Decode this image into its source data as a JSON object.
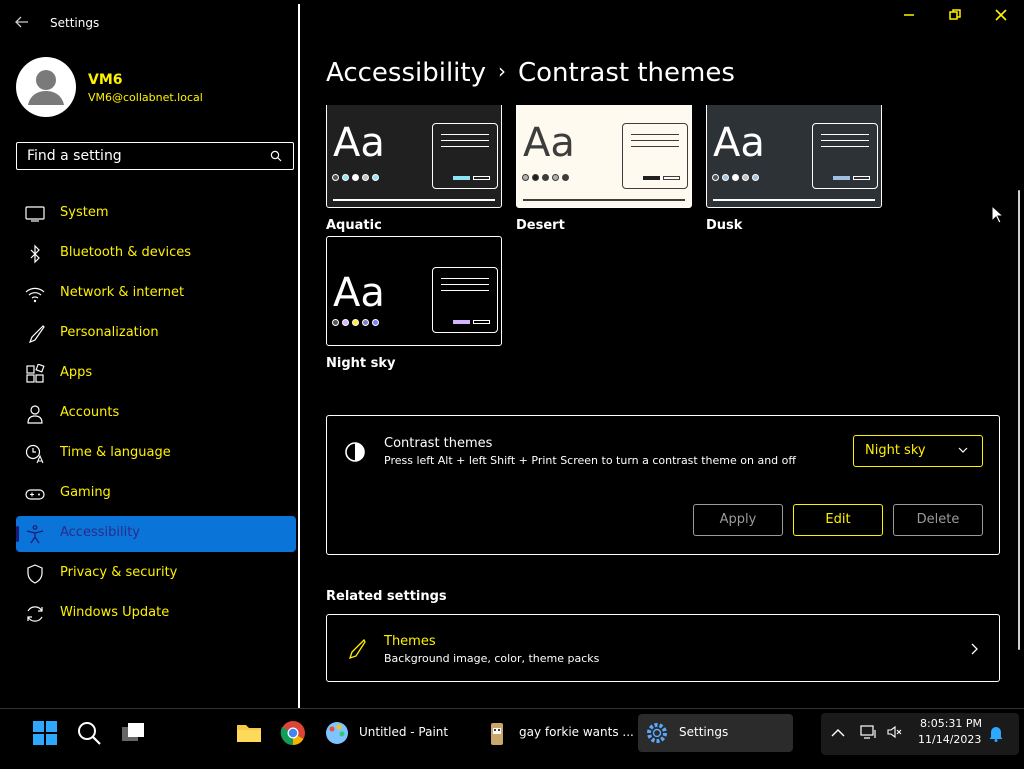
{
  "window": {
    "title": "Settings",
    "controls": {
      "minimize": "—",
      "restore": "⧉",
      "close": "✕"
    }
  },
  "user": {
    "name": "VM6",
    "email": "VM6@collabnet.local"
  },
  "search": {
    "placeholder": "Find a setting"
  },
  "sidebar": {
    "items": [
      {
        "label": "System",
        "icon": "monitor-icon"
      },
      {
        "label": "Bluetooth & devices",
        "icon": "bluetooth-icon"
      },
      {
        "label": "Network & internet",
        "icon": "wifi-icon"
      },
      {
        "label": "Personalization",
        "icon": "brush-icon"
      },
      {
        "label": "Apps",
        "icon": "apps-icon"
      },
      {
        "label": "Accounts",
        "icon": "person-icon"
      },
      {
        "label": "Time & language",
        "icon": "clock-globe-icon"
      },
      {
        "label": "Gaming",
        "icon": "gamepad-icon"
      },
      {
        "label": "Accessibility",
        "icon": "accessibility-icon",
        "selected": true
      },
      {
        "label": "Privacy & security",
        "icon": "shield-icon"
      },
      {
        "label": "Windows Update",
        "icon": "update-icon"
      }
    ]
  },
  "breadcrumb": {
    "parent": "Accessibility",
    "separator": "›",
    "current": "Contrast themes"
  },
  "themes": [
    {
      "label": "Aquatic",
      "bg": "#202020",
      "fg": "#ffffff",
      "accent": "#8ee3f5",
      "dots": [
        "#555555",
        "#8ee3f5",
        "#ffffff",
        "#c0c0c0",
        "#8ee3f5"
      ]
    },
    {
      "label": "Desert",
      "bg": "#fffaef",
      "fg": "#3d3d3d",
      "accent": "#202020",
      "dots": [
        "#b0b0b0",
        "#202020",
        "#3d3d3d",
        "#b0b0b0",
        "#3d3d3d"
      ]
    },
    {
      "label": "Dusk",
      "bg": "#2d3236",
      "fg": "#ffffff",
      "accent": "#a1bfde",
      "dots": [
        "#555555",
        "#a1bfde",
        "#ffffff",
        "#c0c0c0",
        "#a1bfde"
      ]
    },
    {
      "label": "Night sky",
      "bg": "#000000",
      "fg": "#ffffff",
      "accent": "#d6b4fd",
      "dots": [
        "#555555",
        "#d6b4fd",
        "#ffee32",
        "#8080c0",
        "#8080ff"
      ]
    }
  ],
  "panel": {
    "title": "Contrast themes",
    "description": "Press left Alt + left Shift + Print Screen to turn a contrast theme on and off",
    "dropdown_value": "Night sky",
    "apply_label": "Apply",
    "edit_label": "Edit",
    "delete_label": "Delete"
  },
  "related": {
    "heading": "Related settings",
    "themes_title": "Themes",
    "themes_desc": "Background image, color, theme packs"
  },
  "taskbar": {
    "apps": [
      {
        "label": "Untitled - Paint",
        "icon": "paint-icon"
      },
      {
        "label": "gay forkie wants ...",
        "icon": "forky-icon"
      },
      {
        "label": "Settings",
        "icon": "settings-gear-icon",
        "active": true
      }
    ],
    "time": "8:05:31 PM",
    "date": "11/14/2023"
  }
}
